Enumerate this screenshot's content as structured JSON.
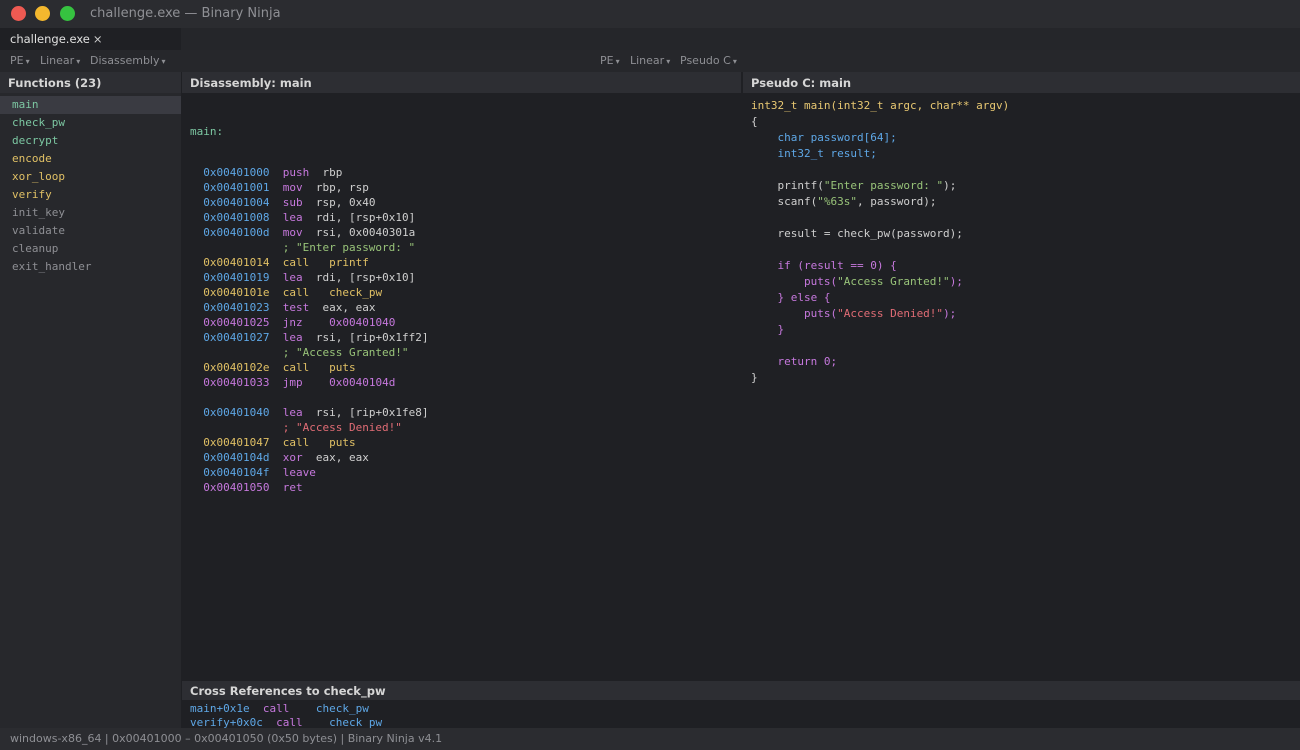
{
  "window": {
    "title": "challenge.exe — Binary Ninja"
  },
  "tabs": [
    {
      "label": "challenge.exe",
      "close": "×"
    }
  ],
  "viewbar_left": [
    {
      "label": "PE",
      "caret": "▾"
    },
    {
      "label": "Linear",
      "caret": "▾"
    },
    {
      "label": "Disassembly",
      "caret": "▾"
    }
  ],
  "viewbar_right": [
    {
      "label": "PE",
      "caret": "▾"
    },
    {
      "label": "Linear",
      "caret": "▾"
    },
    {
      "label": "Pseudo C",
      "caret": "▾"
    }
  ],
  "functions": {
    "header": "Functions (23)",
    "items": [
      {
        "name": "main",
        "color": "#7cc7a2"
      },
      {
        "name": "check_pw",
        "color": "#7cc7a2"
      },
      {
        "name": "decrypt",
        "color": "#7cc7a2"
      },
      {
        "name": "encode",
        "color": "#e0c065"
      },
      {
        "name": "xor_loop",
        "color": "#e0c065"
      },
      {
        "name": "verify",
        "color": "#e0c065"
      },
      {
        "name": "init_key",
        "color": "#8e8f94"
      },
      {
        "name": "validate",
        "color": "#8e8f94"
      },
      {
        "name": "cleanup",
        "color": "#8e8f94"
      },
      {
        "name": "exit_handler",
        "color": "#8e8f94"
      }
    ]
  },
  "disassembly": {
    "header": "Disassembly: main",
    "label": "main:",
    "lines": [
      {
        "addr": "0x00401000",
        "mn": "push",
        "ops": "rbp",
        "kind": "normal"
      },
      {
        "addr": "0x00401001",
        "mn": "mov",
        "ops": "rbp, rsp",
        "kind": "normal"
      },
      {
        "addr": "0x00401004",
        "mn": "sub",
        "ops": "rsp, 0x40",
        "kind": "normal"
      },
      {
        "addr": "0x00401008",
        "mn": "lea",
        "ops": "rdi, [rsp+0x10]",
        "kind": "normal"
      },
      {
        "addr": "0x0040100d",
        "mn": "mov",
        "ops": "rsi, 0x0040301a",
        "kind": "normal"
      },
      {
        "comment": "; \"Enter password: \"",
        "kind": "comment"
      },
      {
        "addr": "0x00401014",
        "mn": "call",
        "ops": "printf",
        "kind": "call"
      },
      {
        "addr": "0x00401019",
        "mn": "lea",
        "ops": "rdi, [rsp+0x10]",
        "kind": "normal"
      },
      {
        "addr": "0x0040101e",
        "mn": "call",
        "ops": "check_pw",
        "kind": "call"
      },
      {
        "addr": "0x00401023",
        "mn": "test",
        "ops": "eax, eax",
        "kind": "normal"
      },
      {
        "addr": "0x00401025",
        "mn": "jnz",
        "ops": "0x00401040",
        "kind": "jump"
      },
      {
        "addr": "0x00401027",
        "mn": "lea",
        "ops": "rsi, [rip+0x1ff2]",
        "kind": "normal"
      },
      {
        "comment": "; \"Access Granted!\"",
        "kind": "comment"
      },
      {
        "addr": "0x0040102e",
        "mn": "call",
        "ops": "puts",
        "kind": "call"
      },
      {
        "addr": "0x00401033",
        "mn": "jmp",
        "ops": "0x0040104d",
        "kind": "jump"
      },
      {
        "kind": "blank"
      },
      {
        "addr": "0x00401040",
        "mn": "lea",
        "ops": "rsi, [rip+0x1fe8]",
        "kind": "normal"
      },
      {
        "comment": "; \"Access Denied!\"",
        "kind": "comment-red"
      },
      {
        "addr": "0x00401047",
        "mn": "call",
        "ops": "puts",
        "kind": "call"
      },
      {
        "addr": "0x0040104d",
        "mn": "xor",
        "ops": "eax, eax",
        "kind": "normal"
      },
      {
        "addr": "0x0040104f",
        "mn": "leave",
        "ops": "",
        "kind": "normal"
      },
      {
        "addr": "0x00401050",
        "mn": "ret",
        "ops": "",
        "kind": "jump-ret"
      }
    ]
  },
  "pseudo_c": {
    "header": "Pseudo C: main",
    "lines": [
      [
        {
          "t": "int32_t main(int32_t argc, char** argv)",
          "c": "sig"
        }
      ],
      [
        {
          "t": "{",
          "c": "plain"
        }
      ],
      [
        {
          "t": "    ",
          "c": "plain"
        },
        {
          "t": "char password[64];",
          "c": "type"
        }
      ],
      [
        {
          "t": "    ",
          "c": "plain"
        },
        {
          "t": "int32_t result;",
          "c": "type"
        }
      ],
      [],
      [
        {
          "t": "    printf(",
          "c": "plain"
        },
        {
          "t": "\"Enter password: \"",
          "c": "str"
        },
        {
          "t": ");",
          "c": "plain"
        }
      ],
      [
        {
          "t": "    scanf(",
          "c": "plain"
        },
        {
          "t": "\"%63s\"",
          "c": "str"
        },
        {
          "t": ", password);",
          "c": "plain"
        }
      ],
      [],
      [
        {
          "t": "    result = check_pw(password);",
          "c": "plain"
        }
      ],
      [],
      [
        {
          "t": "    if (result == 0) {",
          "c": "kw"
        }
      ],
      [
        {
          "t": "        puts(",
          "c": "kw"
        },
        {
          "t": "\"Access Granted!\"",
          "c": "str"
        },
        {
          "t": ");",
          "c": "kw"
        }
      ],
      [
        {
          "t": "    } else {",
          "c": "kw"
        }
      ],
      [
        {
          "t": "        puts(",
          "c": "kw"
        },
        {
          "t": "\"Access Denied!\"",
          "c": "str-red"
        },
        {
          "t": ");",
          "c": "kw"
        }
      ],
      [
        {
          "t": "    }",
          "c": "kw"
        }
      ],
      [],
      [
        {
          "t": "    return 0;",
          "c": "kw"
        }
      ],
      [
        {
          "t": "}",
          "c": "plain"
        }
      ]
    ]
  },
  "xrefs": {
    "header": "Cross References to check_pw",
    "items": [
      {
        "from": "main+0x1e",
        "mn": "call",
        "target": "check_pw"
      },
      {
        "from": "verify+0x0c",
        "mn": "call",
        "target": "check_pw"
      }
    ]
  },
  "status": {
    "text": "windows-x86_64  |  0x00401000 – 0x00401050 (0x50 bytes)  |  Binary Ninja v4.1"
  }
}
